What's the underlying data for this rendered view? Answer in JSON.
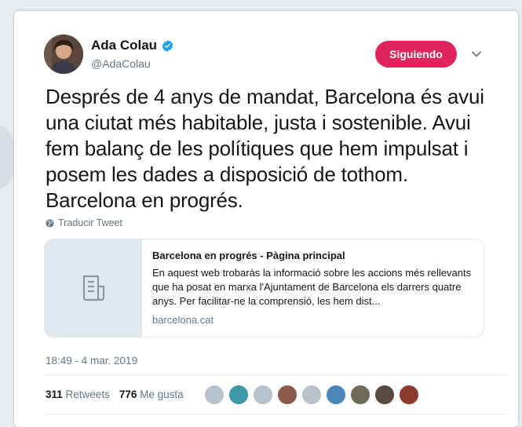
{
  "colors": {
    "follow_bg": "#e0245e",
    "verified": "#1da1f2",
    "muted": "#657786",
    "text": "#14171a"
  },
  "user": {
    "name": "Ada Colau",
    "handle": "@AdaColau",
    "verified_icon": "verified-badge-icon",
    "avatar_icon": "profile-photo"
  },
  "follow_button": {
    "label": "Siguiendo"
  },
  "tweet": {
    "text": "Després de 4 anys de mandat, Barcelona és avui una ciutat més habitable, justa i sostenible. Avui fem balanç de les polítiques que hem impulsat i posem les dades a disposició de tothom. Barcelona en progrés.",
    "translate_label": "Traducir Tweet",
    "timestamp": "18:49 - 4 mar. 2019"
  },
  "link_card": {
    "title": "Barcelona en progrés - Pàgina principal",
    "description": "En aquest web trobaràs la informació sobre les accions més rellevants que ha posat en marxa l'Ajuntament de Barcelona els darrers quatre anys. Per facilitar-ne la comprensió, les hem dist...",
    "domain": "barcelona.cat",
    "thumb_icon": "document-icon"
  },
  "stats": {
    "retweets_count": "311",
    "retweets_label": "Retweets",
    "likes_count": "776",
    "likes_label": "Me gusta"
  },
  "likers": [
    {
      "color": "#b8c2cc"
    },
    {
      "color": "#3a9aa8"
    },
    {
      "color": "#b8c2cc"
    },
    {
      "color": "#8b5a4a"
    },
    {
      "color": "#b8c2cc"
    },
    {
      "color": "#4a86b8"
    },
    {
      "color": "#6e6a55"
    },
    {
      "color": "#5a4a42"
    },
    {
      "color": "#8a3b2e"
    }
  ]
}
